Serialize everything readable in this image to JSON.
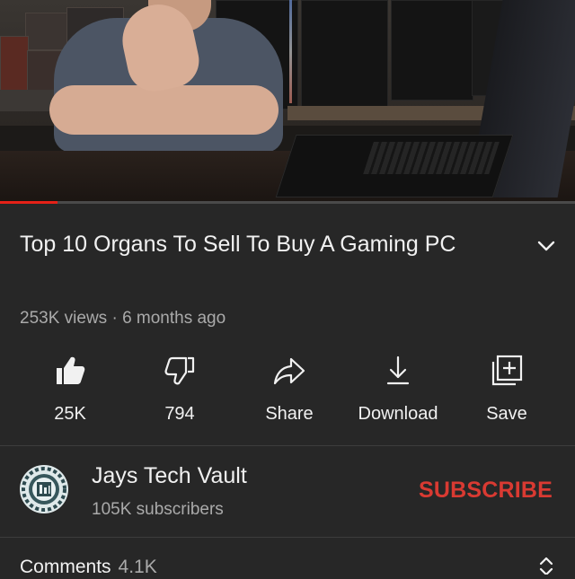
{
  "video": {
    "progress_fraction": 0.1,
    "progress_color": "#e62117"
  },
  "title": "Top 10 Organs To Sell To Buy A Gaming PC",
  "meta": {
    "views": "253K views",
    "separator": "·",
    "age": "6 months ago"
  },
  "actions": [
    {
      "icon": "thumbs-up-icon",
      "label": "25K"
    },
    {
      "icon": "thumbs-down-icon",
      "label": "794"
    },
    {
      "icon": "share-icon",
      "label": "Share"
    },
    {
      "icon": "download-icon",
      "label": "Download"
    },
    {
      "icon": "save-icon",
      "label": "Save"
    }
  ],
  "channel": {
    "name": "Jays Tech Vault",
    "subscribers": "105K subscribers",
    "subscribe_label": "SUBSCRIBE",
    "subscribe_color": "#d93a32"
  },
  "comments": {
    "label": "Comments",
    "count": "4.1K"
  }
}
